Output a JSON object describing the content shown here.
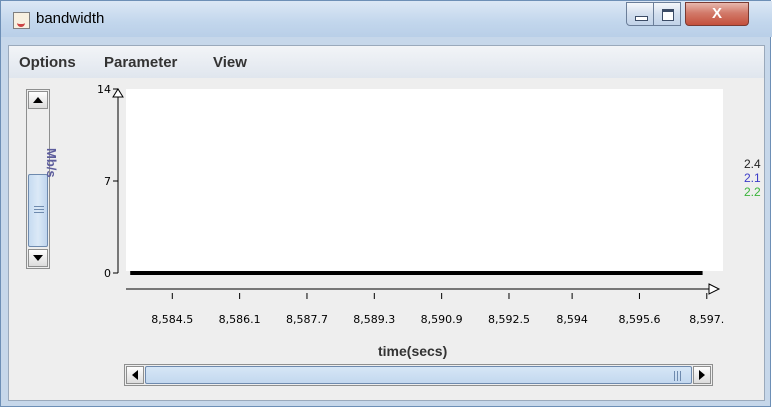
{
  "window": {
    "title": "bandwidth",
    "close_glyph": "X",
    "icon": "java-cup-icon"
  },
  "menu": [
    {
      "label": "Options"
    },
    {
      "label": "Parameter"
    },
    {
      "label": "View"
    }
  ],
  "plot": {
    "ylabel": "Mb/s",
    "xlabel": "time(secs)",
    "legend": [
      {
        "label": "2.4",
        "color": "#222222"
      },
      {
        "label": "2.1",
        "color": "#3c3cc8"
      },
      {
        "label": "2.2",
        "color": "#3cb43c"
      }
    ]
  },
  "chart_data": {
    "type": "line",
    "title": "",
    "xlabel": "time(secs)",
    "ylabel": "Mb/s",
    "ylim": [
      0,
      14
    ],
    "y_ticks": [
      {
        "label": "14",
        "value": 14
      },
      {
        "label": "7",
        "value": 7
      },
      {
        "label": "0",
        "value": 0
      }
    ],
    "x_ticks": [
      "8,584.5",
      "8,586.1",
      "8,587.7",
      "8,589.3",
      "8,590.9",
      "8,592.5",
      "8,594",
      "8,595.6",
      "8,597."
    ],
    "x_tick_values": [
      8584.5,
      8586.1,
      8587.7,
      8589.3,
      8590.9,
      8592.5,
      8594.0,
      8595.6,
      8597.2
    ],
    "xlim": [
      8583.4,
      8597.3
    ],
    "series": [
      {
        "name": "2.4",
        "x": [
          8583.5,
          8597.1
        ],
        "values": [
          0,
          0
        ],
        "color": "#000000"
      }
    ],
    "grid": false
  }
}
